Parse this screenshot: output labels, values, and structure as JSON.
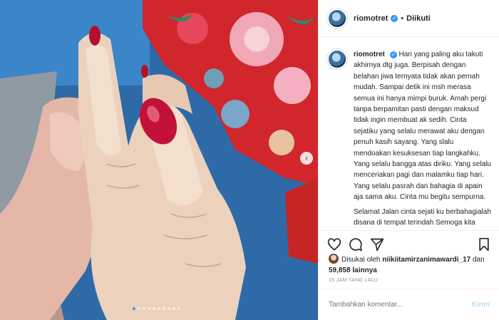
{
  "post": {
    "username": "riomotret",
    "follow_status": "Diikuti",
    "separator": "•",
    "verified_glyph": "✓"
  },
  "carousel": {
    "total_slides": 10,
    "active_slide": 1,
    "next_glyph": "›"
  },
  "caption": {
    "username": "riomotret",
    "paragraph1": "Hari yang paling aku takuti akhirnya dtg juga. Berpisah dengan belahan jiwa ternyata tidak akan pernah mudah. Sampai detik ini msh merasa semua ini hanya mimpi buruk. Amah pergi tanpa berpamitan pasti dengan maksud tidak ingin membuat ak sedih. Cinta sejatiku yang selalu merawat aku dengan penuh kasih sayang. Yang slalu mendoakan kesuksesan tiap langkahku. Yang selalu bangga atas diriku. Yang selalu menceriakan pagi dan malamku tiap hari. Yang selalu pasrah dan bahagia di apain aja sama aku. Cinta mu begitu sempurna.",
    "paragraph2": "Selamat Jalan cinta sejati ku berbahagialah disana di tempat terindah Semoga kita bertemu lagi"
  },
  "actions": {
    "like_icon": "heart-icon",
    "comment_icon": "comment-icon",
    "share_icon": "share-icon",
    "save_icon": "bookmark-icon"
  },
  "likes": {
    "prefix": "Disukai oleh",
    "first_user": "niikiitamirzanimawardi_17",
    "connector": "dan",
    "count": "59,858",
    "suffix": "lainnya"
  },
  "timestamp": "15 JAM YANG LALU",
  "comment": {
    "placeholder": "Tambahkan komentar...",
    "send_label": "Kirim"
  },
  "colors": {
    "verified": "#3897f0",
    "send_disabled": "#b2dffc",
    "nail_polish": "#c2123a"
  }
}
